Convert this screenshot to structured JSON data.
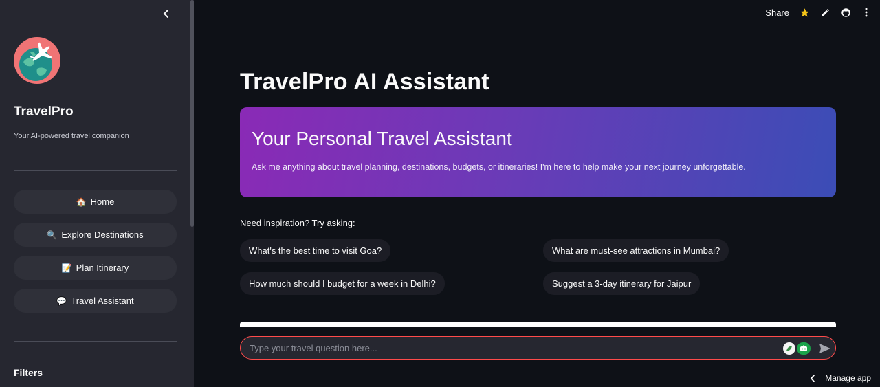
{
  "sidebar": {
    "brand_title": "TravelPro",
    "brand_subtitle": "Your AI-powered travel companion",
    "logo_icon": "globe-airplane-icon",
    "nav": [
      {
        "icon": "🏠",
        "icon_name": "house-icon",
        "label": "Home"
      },
      {
        "icon": "🔍",
        "icon_name": "magnifier-icon",
        "label": "Explore Destinations"
      },
      {
        "icon": "📝",
        "icon_name": "memo-icon",
        "label": "Plan Itinerary"
      },
      {
        "icon": "💬",
        "icon_name": "speech-bubble-icon",
        "label": "Travel Assistant"
      }
    ],
    "filters_heading": "Filters"
  },
  "topbar": {
    "share_label": "Share",
    "icons": [
      "star-icon",
      "pencil-icon",
      "github-icon",
      "more-icon"
    ]
  },
  "main": {
    "title": "TravelPro AI Assistant",
    "hero": {
      "title": "Your Personal Travel Assistant",
      "text": "Ask me anything about travel planning, destinations, budgets, or itineraries! I'm here to help make your next journey unforgettable."
    },
    "inspiration_label": "Need inspiration? Try asking:",
    "suggestions": [
      "What's the best time to visit Goa?",
      "What are must-see attractions in Mumbai?",
      "How much should I budget for a week in Delhi?",
      "Suggest a 3-day itinerary for Jaipur"
    ],
    "chat_input": {
      "placeholder": "Type your travel question here...",
      "value": ""
    }
  },
  "footer": {
    "manage_label": "Manage app"
  },
  "colors": {
    "background": "#0e1117",
    "sidebar": "#262730",
    "accent": "#ff4b4b",
    "hero_gradient_start": "#8a2ab6",
    "hero_gradient_end": "#3b4db6",
    "star": "#f5c518"
  }
}
